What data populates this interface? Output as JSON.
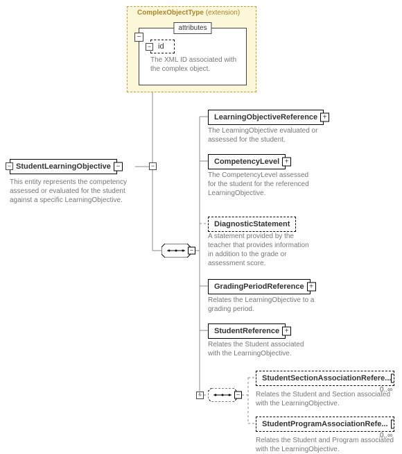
{
  "extension": {
    "title": "ComplexObjectType",
    "suffix": "(extension)",
    "attributes_label": "attributes",
    "id_field": "id",
    "id_desc": "The XML ID associated with the complex object."
  },
  "root": {
    "name": "StudentLearningObjective",
    "desc": "This entity represents the competency assessed or evaluated for the student against a specific LearningObjective."
  },
  "children": [
    {
      "name": "LearningObjectiveReference",
      "desc": "The  LearningObjective evaluated or assessed for the student.",
      "optional": false,
      "expand": true
    },
    {
      "name": "CompetencyLevel",
      "desc": "The CompetencyLevel assessed for the student for the referenced LearningObjective.",
      "optional": false,
      "expand": true
    },
    {
      "name": "DiagnosticStatement",
      "desc": "A statement provided by the teacher that provides information in addition to the grade or assessment score.",
      "optional": true,
      "expand": false
    },
    {
      "name": "GradingPeriodReference",
      "desc": "Relates the LearningObjective to a grading period.",
      "optional": false,
      "expand": true
    },
    {
      "name": "StudentReference",
      "desc": "Relates the Student associated with the LearningObjective.",
      "optional": false,
      "expand": true
    }
  ],
  "opt_children": [
    {
      "name": "StudentSectionAssociationRefere...",
      "desc": "Relates the Student and Section associated with the LearningObjective.",
      "card": "0..∞"
    },
    {
      "name": "StudentProgramAssociationRefe...",
      "desc": "Relates the Student and Program associated with the LearningObjective.",
      "card": "0..∞"
    }
  ],
  "glyphs": {
    "plus": "+",
    "minus": "−"
  }
}
